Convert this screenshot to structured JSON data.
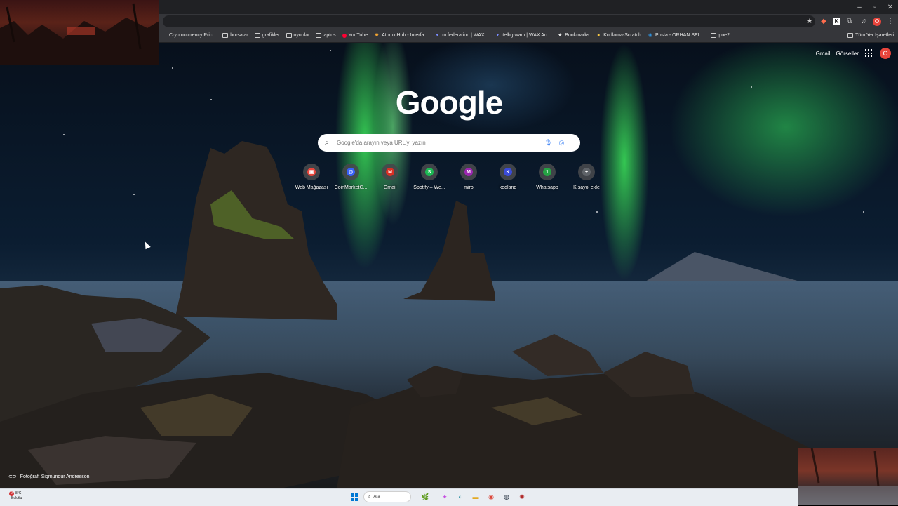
{
  "browser": {
    "window_controls": [
      "–",
      "▫",
      "✕"
    ],
    "bookmarks": [
      {
        "label": "Cryptocurrency Pric...",
        "icon": "site-icon"
      },
      {
        "label": "borsalar",
        "icon": "folder-icon"
      },
      {
        "label": "grafikler",
        "icon": "folder-icon"
      },
      {
        "label": "oyunlar",
        "icon": "folder-icon"
      },
      {
        "label": "aptos",
        "icon": "folder-icon"
      },
      {
        "label": "YouTube",
        "icon": "youtube-icon"
      },
      {
        "label": "AtomicHub - Interfa...",
        "icon": "atomichub-icon"
      },
      {
        "label": "m.federation | WAX...",
        "icon": "wax-icon"
      },
      {
        "label": "telbg.wam | WAX Ac...",
        "icon": "wax-icon"
      },
      {
        "label": "Bookmarks",
        "icon": "star-icon"
      },
      {
        "label": "Kodlama-Scratch",
        "icon": "scratch-icon"
      },
      {
        "label": "Posta - ORHAN SEL...",
        "icon": "outlook-icon"
      },
      {
        "label": "poe2",
        "icon": "folder-icon"
      }
    ],
    "other_bookmarks": "Tüm Yer İşaretleri",
    "profile_initial": "O"
  },
  "ntp": {
    "gmail_link": "Gmail",
    "images_link": "Görseller",
    "avatar_initial": "O",
    "logo": "Google",
    "search_placeholder": "Google'da arayın veya URL'yi yazın",
    "shortcuts": [
      {
        "label": "Web Mağazası",
        "glyph": "▣",
        "color": "#e8453c"
      },
      {
        "label": "CoinMarketC...",
        "glyph": "@",
        "color": "#3861fb"
      },
      {
        "label": "Gmail",
        "glyph": "M",
        "color": "#d93025"
      },
      {
        "label": "Spotify – We...",
        "glyph": "S",
        "color": "#1db954"
      },
      {
        "label": "miro",
        "glyph": "M",
        "color": "#9c27b0"
      },
      {
        "label": "kodland",
        "glyph": "K",
        "color": "#3b4bd8"
      },
      {
        "label": "Whatsapp",
        "glyph": "1",
        "color": "#25a244"
      },
      {
        "label": "Kısayol ekle",
        "glyph": "+",
        "color": "#5f6368"
      }
    ],
    "photo_credit": "Fotoğraf: Sigmundur Andresson"
  },
  "taskbar": {
    "weather_temp": "8°C",
    "weather_desc": "Bulutlu",
    "weather_badge": "2",
    "search_label": "Ara"
  }
}
